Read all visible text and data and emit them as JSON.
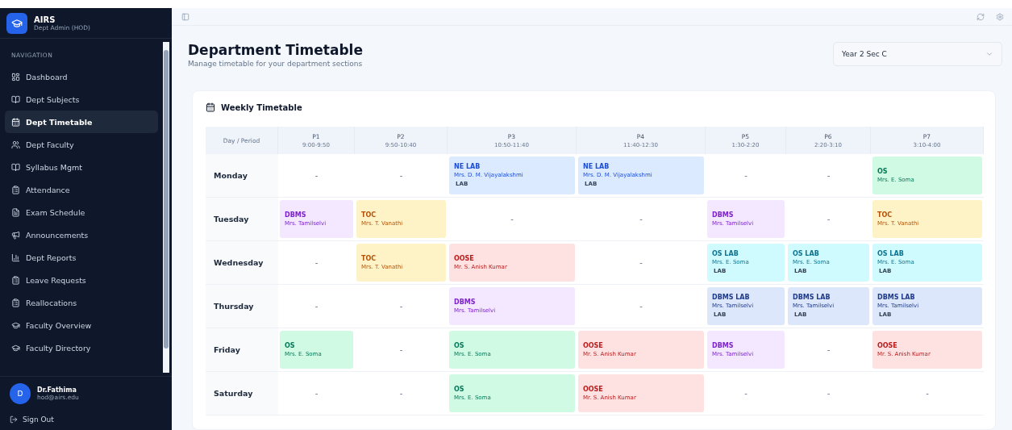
{
  "sidebar": {
    "app_name": "AIRS",
    "role": "Dept Admin (HOD)",
    "section_label": "NAVIGATION",
    "items": [
      {
        "label": "Dashboard",
        "selected": false
      },
      {
        "label": "Dept Subjects",
        "selected": false
      },
      {
        "label": "Dept Timetable",
        "selected": true
      },
      {
        "label": "Dept Faculty",
        "selected": false
      },
      {
        "label": "Syllabus Mgmt",
        "selected": false
      },
      {
        "label": "Attendance",
        "selected": false
      },
      {
        "label": "Exam Schedule",
        "selected": false
      },
      {
        "label": "Announcements",
        "selected": false
      },
      {
        "label": "Dept Reports",
        "selected": false
      },
      {
        "label": "Leave Requests",
        "selected": false
      },
      {
        "label": "Reallocations",
        "selected": false
      },
      {
        "label": "Faculty Overview",
        "selected": false
      },
      {
        "label": "Faculty Directory",
        "selected": false
      }
    ],
    "user": {
      "initial": "D",
      "name": "Dr.Fathima",
      "email": "hod@airs.edu"
    },
    "sign_out": "Sign Out"
  },
  "page": {
    "title": "Department Timetable",
    "subtitle": "Manage timetable for your department sections",
    "section_select": "Year 2 Sec C"
  },
  "timetable": {
    "title": "Weekly Timetable",
    "corner": "Day / Period",
    "periods": [
      {
        "label": "P1",
        "time": "9:00-9:50"
      },
      {
        "label": "P2",
        "time": "9:50-10:40"
      },
      {
        "label": "P3",
        "time": "10:50-11:40"
      },
      {
        "label": "P4",
        "time": "11:40-12:30"
      },
      {
        "label": "P5",
        "time": "1:30-2:20"
      },
      {
        "label": "P6",
        "time": "2:20-3:10"
      },
      {
        "label": "P7",
        "time": "3:10-4:00"
      }
    ],
    "rows": [
      {
        "day": "Monday",
        "cells": [
          {
            "kind": "empty",
            "text": "-"
          },
          {
            "kind": "empty",
            "text": "-"
          },
          {
            "kind": "class",
            "subject": "NE LAB",
            "teacher": "Mrs. D. M. Vijayalakshmi",
            "tag": "LAB",
            "color": "#dbeafe"
          },
          {
            "kind": "class",
            "subject": "NE LAB",
            "teacher": "Mrs. D. M. Vijayalakshmi",
            "tag": "LAB",
            "color": "#dbeafe"
          },
          {
            "kind": "empty",
            "text": "-"
          },
          {
            "kind": "empty",
            "text": "-"
          },
          {
            "kind": "class",
            "subject": "OS",
            "teacher": "Mrs. E. Soma",
            "color": "#d1fae5"
          }
        ]
      },
      {
        "day": "Tuesday",
        "cells": [
          {
            "kind": "class",
            "subject": "DBMS",
            "teacher": "Mrs. Tamilselvi",
            "color": "#f3e8ff"
          },
          {
            "kind": "class",
            "subject": "TOC",
            "teacher": "Mrs. T. Vanathi",
            "color": "#fef3c7"
          },
          {
            "kind": "empty",
            "text": "-"
          },
          {
            "kind": "empty",
            "text": "-"
          },
          {
            "kind": "class",
            "subject": "DBMS",
            "teacher": "Mrs. Tamilselvi",
            "color": "#f3e8ff"
          },
          {
            "kind": "empty",
            "text": "-"
          },
          {
            "kind": "class",
            "subject": "TOC",
            "teacher": "Mrs. T. Vanathi",
            "color": "#fef3c7"
          }
        ]
      },
      {
        "day": "Wednesday",
        "cells": [
          {
            "kind": "empty",
            "text": "-"
          },
          {
            "kind": "class",
            "subject": "TOC",
            "teacher": "Mrs. T. Vanathi",
            "color": "#fef3c7"
          },
          {
            "kind": "class",
            "subject": "OOSE",
            "teacher": "Mr. S. Anish Kumar",
            "color": "#fee2e2"
          },
          {
            "kind": "empty",
            "text": "-"
          },
          {
            "kind": "class",
            "subject": "OS LAB",
            "teacher": "Mrs. E. Soma",
            "tag": "LAB",
            "color": "#cffafe"
          },
          {
            "kind": "class",
            "subject": "OS LAB",
            "teacher": "Mrs. E. Soma",
            "tag": "LAB",
            "color": "#cffafe"
          },
          {
            "kind": "class",
            "subject": "OS LAB",
            "teacher": "Mrs. E. Soma",
            "tag": "LAB",
            "color": "#cffafe"
          }
        ]
      },
      {
        "day": "Thursday",
        "cells": [
          {
            "kind": "empty",
            "text": "-"
          },
          {
            "kind": "empty",
            "text": "-"
          },
          {
            "kind": "class",
            "subject": "DBMS",
            "teacher": "Mrs. Tamilselvi",
            "color": "#f3e8ff"
          },
          {
            "kind": "empty",
            "text": "-"
          },
          {
            "kind": "class",
            "subject": "DBMS LAB",
            "teacher": "Mrs. Tamilselvi",
            "tag": "LAB",
            "color": "#dde7fb"
          },
          {
            "kind": "class",
            "subject": "DBMS LAB",
            "teacher": "Mrs. Tamilselvi",
            "tag": "LAB",
            "color": "#dde7fb"
          },
          {
            "kind": "class",
            "subject": "DBMS LAB",
            "teacher": "Mrs. Tamilselvi",
            "tag": "LAB",
            "color": "#dde7fb"
          }
        ]
      },
      {
        "day": "Friday",
        "cells": [
          {
            "kind": "class",
            "subject": "OS",
            "teacher": "Mrs. E. Soma",
            "color": "#d1fae5"
          },
          {
            "kind": "empty",
            "text": "-"
          },
          {
            "kind": "class",
            "subject": "OS",
            "teacher": "Mrs. E. Soma",
            "color": "#d1fae5"
          },
          {
            "kind": "class",
            "subject": "OOSE",
            "teacher": "Mr. S. Anish Kumar",
            "color": "#fee2e2"
          },
          {
            "kind": "class",
            "subject": "DBMS",
            "teacher": "Mrs. Tamilselvi",
            "color": "#f3e8ff"
          },
          {
            "kind": "empty",
            "text": "-"
          },
          {
            "kind": "class",
            "subject": "OOSE",
            "teacher": "Mr. S. Anish Kumar",
            "color": "#fee2e2"
          }
        ]
      },
      {
        "day": "Saturday",
        "cells": [
          {
            "kind": "empty",
            "text": "-"
          },
          {
            "kind": "empty",
            "text": "-"
          },
          {
            "kind": "class",
            "subject": "OS",
            "teacher": "Mrs. E. Soma",
            "color": "#d1fae5"
          },
          {
            "kind": "class",
            "subject": "OOSE",
            "teacher": "Mr. S. Anish Kumar",
            "color": "#fee2e2"
          },
          {
            "kind": "empty",
            "text": "-"
          },
          {
            "kind": "empty",
            "text": "-"
          },
          {
            "kind": "empty",
            "text": "-"
          }
        ]
      }
    ]
  }
}
